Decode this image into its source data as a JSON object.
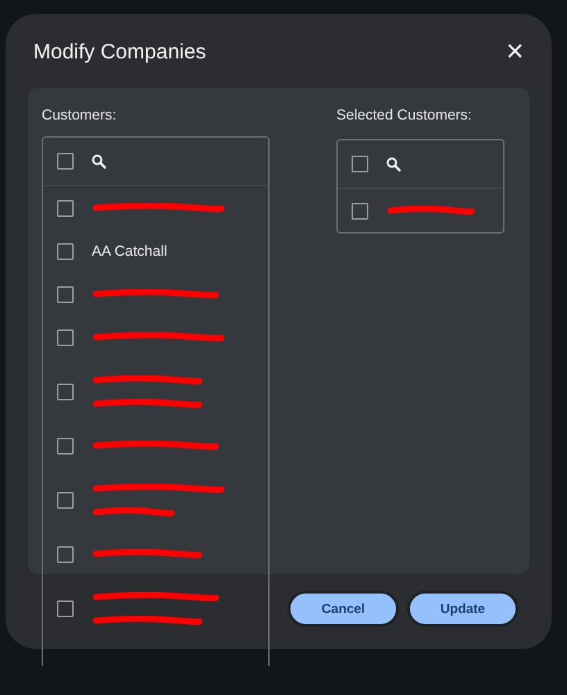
{
  "dialog": {
    "title": "Modify Companies",
    "close": "×"
  },
  "customers": {
    "label": "Customers:",
    "select_all": {
      "checked": false
    },
    "items": [
      {
        "kind": "redacted",
        "checked": false
      },
      {
        "kind": "text",
        "name": "AA Catchall",
        "checked": false
      },
      {
        "kind": "redacted",
        "checked": false
      },
      {
        "kind": "redacted",
        "checked": false
      },
      {
        "kind": "redacted_two_lines",
        "checked": false
      },
      {
        "kind": "redacted",
        "checked": false
      },
      {
        "kind": "redacted_two_lines",
        "checked": false
      },
      {
        "kind": "redacted",
        "checked": false
      },
      {
        "kind": "redacted_two_lines",
        "checked": false
      }
    ]
  },
  "selected_customers": {
    "label": "Selected Customers:",
    "select_all": {
      "checked": false
    },
    "items": [
      {
        "kind": "redacted",
        "checked": false
      }
    ]
  },
  "buttons": [
    "Cancel",
    "Update"
  ]
}
